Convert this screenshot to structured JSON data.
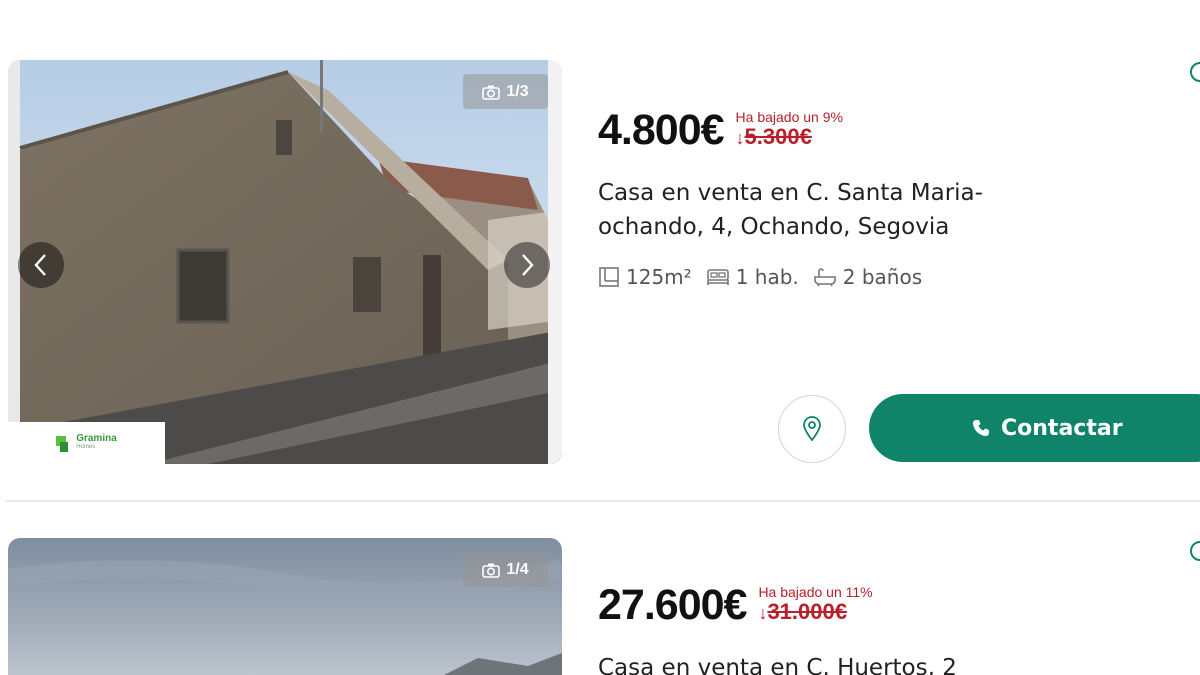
{
  "listings": [
    {
      "photo_counter": "1/3",
      "agency_logo": {
        "name": "Gramina",
        "sub": "Homes"
      },
      "price": "4.800€",
      "drop_label": "Ha bajado un 9%",
      "drop_arrow": "↓",
      "old_price": "5.300€",
      "title": "Casa en venta en C. Santa Maria-ochando, 4, Ochando, Segovia",
      "features": {
        "area": "125m²",
        "rooms": "1 hab.",
        "baths": "2 baños"
      },
      "contact_label": "Contactar"
    },
    {
      "photo_counter": "1/4",
      "price": "27.600€",
      "drop_label": "Ha bajado un 11%",
      "drop_arrow": "↓",
      "old_price": "31.000€",
      "title": "Casa en venta en C. Huertos, 2"
    }
  ],
  "colors": {
    "accent": "#0f8468",
    "price_drop": "#b8202a"
  },
  "icons": [
    "camera-icon",
    "chevron-left-icon",
    "chevron-right-icon",
    "floor-plan-icon",
    "bed-icon",
    "bathtub-icon",
    "map-pin-icon",
    "phone-icon"
  ]
}
